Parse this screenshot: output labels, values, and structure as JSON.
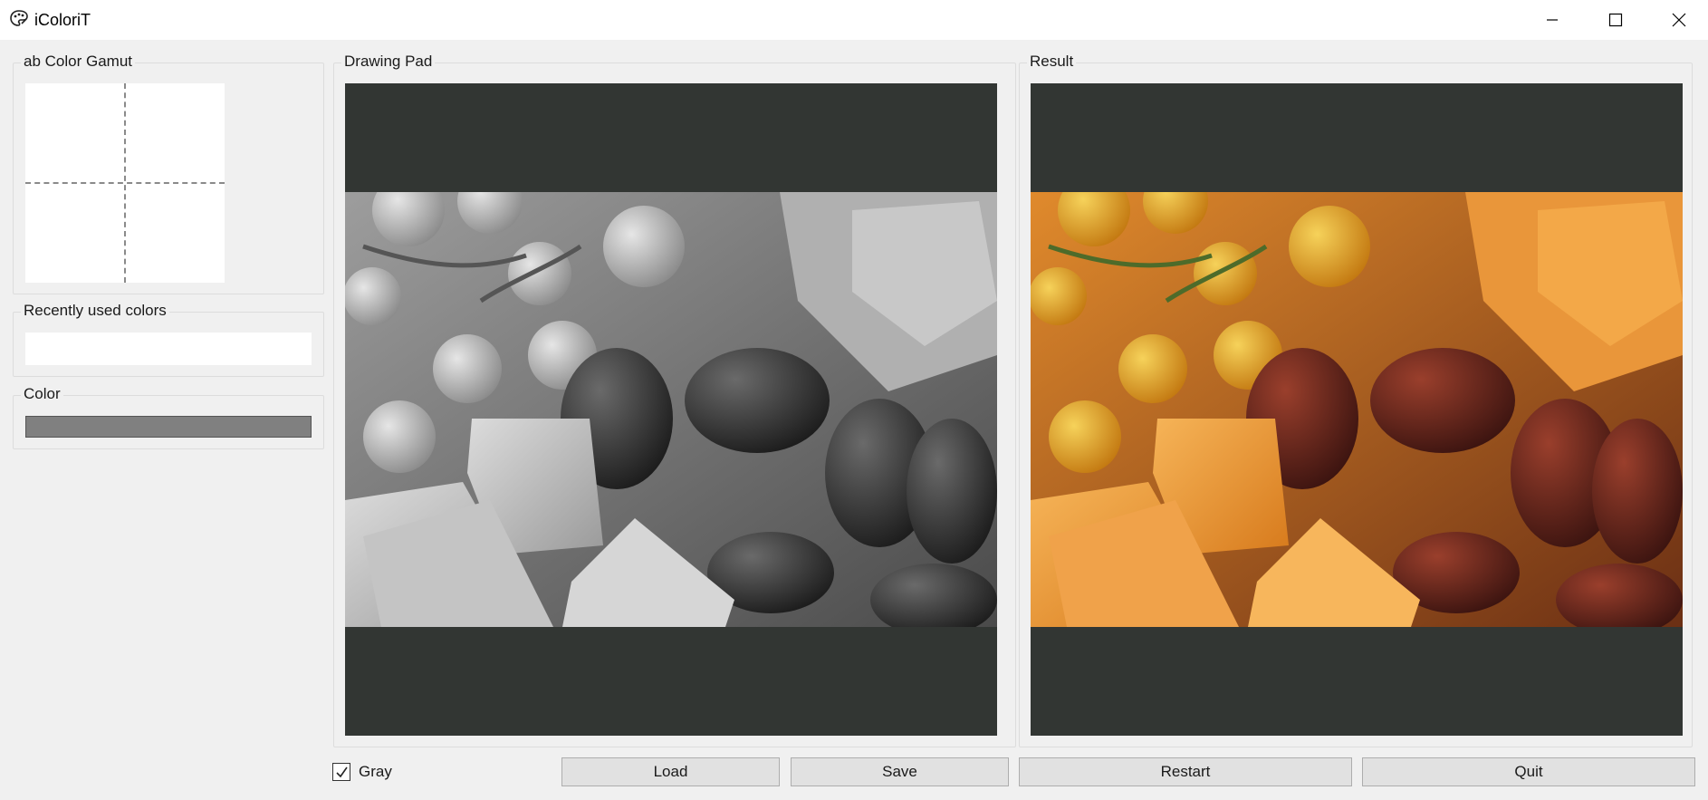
{
  "window": {
    "title": "iColoriT",
    "controls": [
      "minimize",
      "maximize",
      "close"
    ]
  },
  "panels": {
    "gamut": {
      "label": "ab Color Gamut"
    },
    "recent": {
      "label": "Recently used colors"
    },
    "color": {
      "label": "Color",
      "current_color": "#808080"
    },
    "drawing_pad": {
      "label": "Drawing Pad"
    },
    "result": {
      "label": "Result"
    }
  },
  "controls": {
    "gray": {
      "label": "Gray",
      "checked": true
    },
    "load_label": "Load",
    "save_label": "Save",
    "restart_label": "Restart",
    "quit_label": "Quit"
  },
  "colors": {
    "canvas_bg": "#323633",
    "window_bg": "#f0f0f0"
  }
}
